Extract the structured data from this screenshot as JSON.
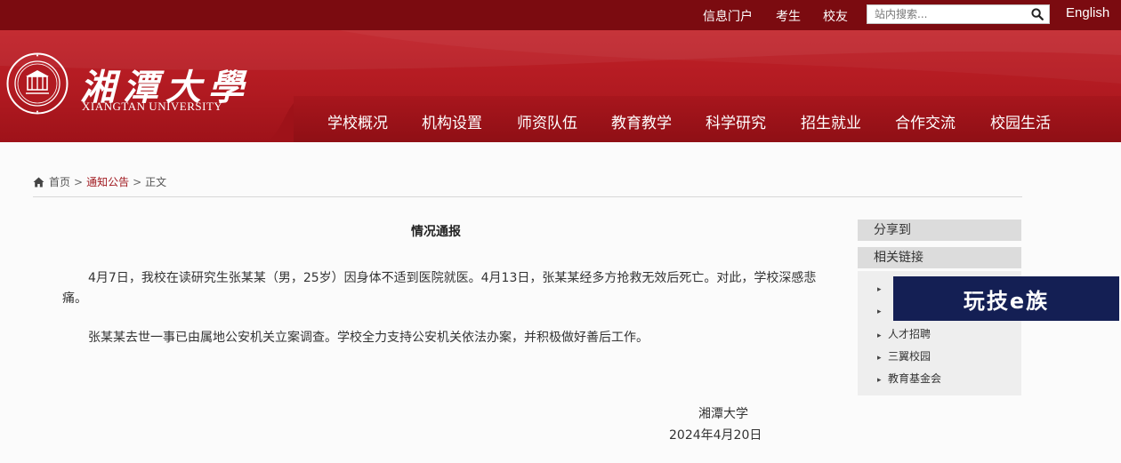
{
  "topbar": {
    "links": [
      "信息门户",
      "考生",
      "校友"
    ],
    "search_placeholder": "站内搜索...",
    "search_icon": "search-icon",
    "language": "English"
  },
  "brand": {
    "name_cn": "湘潭大學",
    "name_en": "XIANGTAN UNIVERSITY",
    "seal_icon": "university-seal-logo"
  },
  "nav": {
    "items": [
      "学校概况",
      "机构设置",
      "师资队伍",
      "教育教学",
      "科学研究",
      "招生就业",
      "合作交流",
      "校园生活"
    ]
  },
  "breadcrumb": {
    "home": "首页",
    "section": "通知公告",
    "page": "正文",
    "separator": ">"
  },
  "article": {
    "title": "情况通报",
    "paragraphs": [
      "4月7日，我校在读研究生张某某（男，25岁）因身体不适到医院就医。4月13日，张某某经多方抢救无效后死亡。对此，学校深感悲痛。",
      "张某某去世一事已由属地公安机关立案调查。学校全力支持公安机关依法办案，并积极做好善后工作。"
    ],
    "signature": "湘潭大学",
    "date": "2024年4月20日"
  },
  "sidebar": {
    "share_title": "分享到",
    "links_title": "相关链接",
    "links": [
      "人才招聘",
      "三翼校园",
      "教育基金会"
    ]
  },
  "overlay": {
    "text": "玩技e族"
  },
  "colors": {
    "topbar": "#7b0b10",
    "header": "#b11a21",
    "accent": "#a11a20"
  }
}
